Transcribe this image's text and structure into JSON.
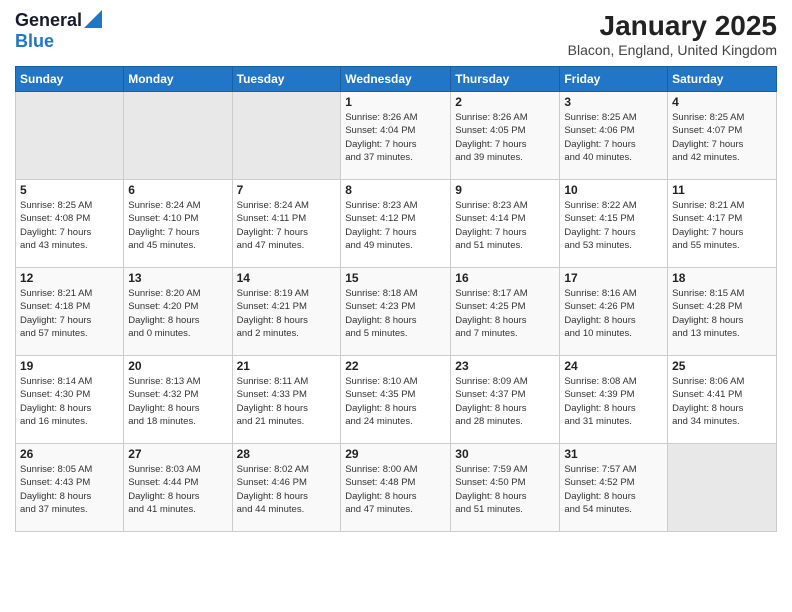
{
  "header": {
    "logo_line1": "General",
    "logo_line2": "Blue",
    "title": "January 2025",
    "subtitle": "Blacon, England, United Kingdom"
  },
  "weekdays": [
    "Sunday",
    "Monday",
    "Tuesday",
    "Wednesday",
    "Thursday",
    "Friday",
    "Saturday"
  ],
  "weeks": [
    [
      {
        "day": "",
        "detail": ""
      },
      {
        "day": "",
        "detail": ""
      },
      {
        "day": "",
        "detail": ""
      },
      {
        "day": "1",
        "detail": "Sunrise: 8:26 AM\nSunset: 4:04 PM\nDaylight: 7 hours\nand 37 minutes."
      },
      {
        "day": "2",
        "detail": "Sunrise: 8:26 AM\nSunset: 4:05 PM\nDaylight: 7 hours\nand 39 minutes."
      },
      {
        "day": "3",
        "detail": "Sunrise: 8:25 AM\nSunset: 4:06 PM\nDaylight: 7 hours\nand 40 minutes."
      },
      {
        "day": "4",
        "detail": "Sunrise: 8:25 AM\nSunset: 4:07 PM\nDaylight: 7 hours\nand 42 minutes."
      }
    ],
    [
      {
        "day": "5",
        "detail": "Sunrise: 8:25 AM\nSunset: 4:08 PM\nDaylight: 7 hours\nand 43 minutes."
      },
      {
        "day": "6",
        "detail": "Sunrise: 8:24 AM\nSunset: 4:10 PM\nDaylight: 7 hours\nand 45 minutes."
      },
      {
        "day": "7",
        "detail": "Sunrise: 8:24 AM\nSunset: 4:11 PM\nDaylight: 7 hours\nand 47 minutes."
      },
      {
        "day": "8",
        "detail": "Sunrise: 8:23 AM\nSunset: 4:12 PM\nDaylight: 7 hours\nand 49 minutes."
      },
      {
        "day": "9",
        "detail": "Sunrise: 8:23 AM\nSunset: 4:14 PM\nDaylight: 7 hours\nand 51 minutes."
      },
      {
        "day": "10",
        "detail": "Sunrise: 8:22 AM\nSunset: 4:15 PM\nDaylight: 7 hours\nand 53 minutes."
      },
      {
        "day": "11",
        "detail": "Sunrise: 8:21 AM\nSunset: 4:17 PM\nDaylight: 7 hours\nand 55 minutes."
      }
    ],
    [
      {
        "day": "12",
        "detail": "Sunrise: 8:21 AM\nSunset: 4:18 PM\nDaylight: 7 hours\nand 57 minutes."
      },
      {
        "day": "13",
        "detail": "Sunrise: 8:20 AM\nSunset: 4:20 PM\nDaylight: 8 hours\nand 0 minutes."
      },
      {
        "day": "14",
        "detail": "Sunrise: 8:19 AM\nSunset: 4:21 PM\nDaylight: 8 hours\nand 2 minutes."
      },
      {
        "day": "15",
        "detail": "Sunrise: 8:18 AM\nSunset: 4:23 PM\nDaylight: 8 hours\nand 5 minutes."
      },
      {
        "day": "16",
        "detail": "Sunrise: 8:17 AM\nSunset: 4:25 PM\nDaylight: 8 hours\nand 7 minutes."
      },
      {
        "day": "17",
        "detail": "Sunrise: 8:16 AM\nSunset: 4:26 PM\nDaylight: 8 hours\nand 10 minutes."
      },
      {
        "day": "18",
        "detail": "Sunrise: 8:15 AM\nSunset: 4:28 PM\nDaylight: 8 hours\nand 13 minutes."
      }
    ],
    [
      {
        "day": "19",
        "detail": "Sunrise: 8:14 AM\nSunset: 4:30 PM\nDaylight: 8 hours\nand 16 minutes."
      },
      {
        "day": "20",
        "detail": "Sunrise: 8:13 AM\nSunset: 4:32 PM\nDaylight: 8 hours\nand 18 minutes."
      },
      {
        "day": "21",
        "detail": "Sunrise: 8:11 AM\nSunset: 4:33 PM\nDaylight: 8 hours\nand 21 minutes."
      },
      {
        "day": "22",
        "detail": "Sunrise: 8:10 AM\nSunset: 4:35 PM\nDaylight: 8 hours\nand 24 minutes."
      },
      {
        "day": "23",
        "detail": "Sunrise: 8:09 AM\nSunset: 4:37 PM\nDaylight: 8 hours\nand 28 minutes."
      },
      {
        "day": "24",
        "detail": "Sunrise: 8:08 AM\nSunset: 4:39 PM\nDaylight: 8 hours\nand 31 minutes."
      },
      {
        "day": "25",
        "detail": "Sunrise: 8:06 AM\nSunset: 4:41 PM\nDaylight: 8 hours\nand 34 minutes."
      }
    ],
    [
      {
        "day": "26",
        "detail": "Sunrise: 8:05 AM\nSunset: 4:43 PM\nDaylight: 8 hours\nand 37 minutes."
      },
      {
        "day": "27",
        "detail": "Sunrise: 8:03 AM\nSunset: 4:44 PM\nDaylight: 8 hours\nand 41 minutes."
      },
      {
        "day": "28",
        "detail": "Sunrise: 8:02 AM\nSunset: 4:46 PM\nDaylight: 8 hours\nand 44 minutes."
      },
      {
        "day": "29",
        "detail": "Sunrise: 8:00 AM\nSunset: 4:48 PM\nDaylight: 8 hours\nand 47 minutes."
      },
      {
        "day": "30",
        "detail": "Sunrise: 7:59 AM\nSunset: 4:50 PM\nDaylight: 8 hours\nand 51 minutes."
      },
      {
        "day": "31",
        "detail": "Sunrise: 7:57 AM\nSunset: 4:52 PM\nDaylight: 8 hours\nand 54 minutes."
      },
      {
        "day": "",
        "detail": ""
      }
    ]
  ]
}
